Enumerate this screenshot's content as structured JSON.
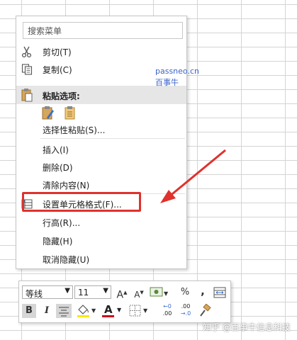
{
  "context_menu": {
    "search_placeholder": "搜索菜单",
    "cut_label": "剪切(T)",
    "copy_label": "复制(C)",
    "paste_options_label": "粘贴选项:",
    "paste_special_label": "选择性粘贴(S)...",
    "insert_label": "插入(I)",
    "delete_label": "删除(D)",
    "clear_contents_label": "清除内容(N)",
    "format_cells_label": "设置单元格格式(F)...",
    "row_height_label": "行高(R)...",
    "hide_label": "隐藏(H)",
    "unhide_label": "取消隐藏(U)"
  },
  "watermark": {
    "line1": "passneo.cn",
    "line2": "百事牛"
  },
  "mini_toolbar": {
    "font_name": "等线",
    "font_size": "11",
    "grow_font": "A",
    "shrink_font": "A",
    "percent": "%",
    "comma": ",",
    "bold": "B",
    "italic": "I",
    "font_color_letter": "A",
    "increase_decimal_top": "←0",
    "increase_decimal_bottom": ".00",
    "decrease_decimal_top": ".00",
    "decrease_decimal_bottom": "→.0"
  },
  "credit": "知乎 @百事牛信息科技",
  "colors": {
    "highlight": "#e0312c",
    "arrow": "#e0312c",
    "watermark": "#3c64c8",
    "font_color_bar": "#d0021b"
  }
}
